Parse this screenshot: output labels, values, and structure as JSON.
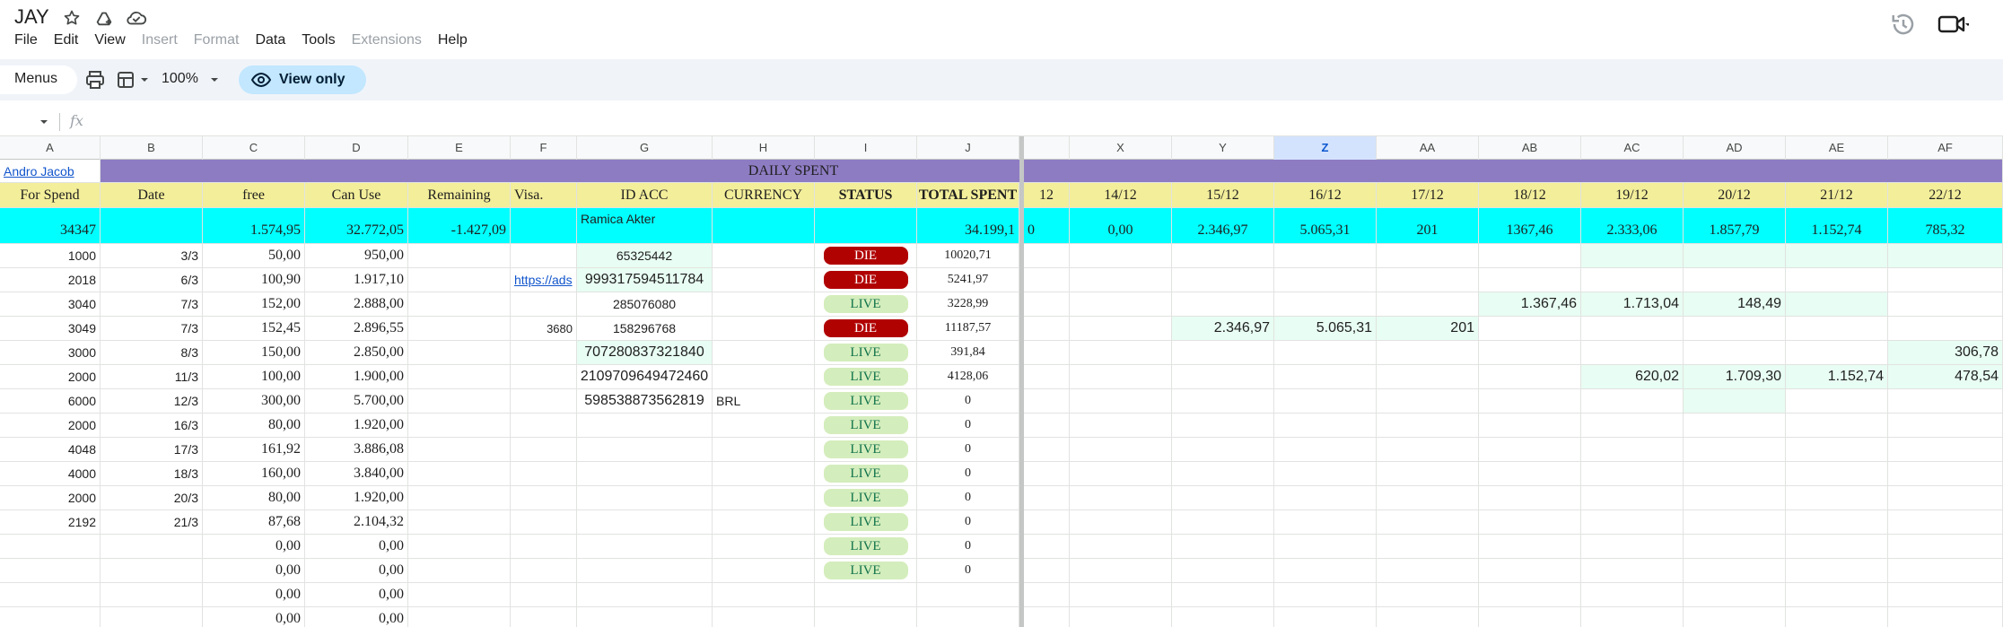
{
  "app": {
    "title": "JAY",
    "menus": [
      {
        "label": "File",
        "disabled": false
      },
      {
        "label": "Edit",
        "disabled": false
      },
      {
        "label": "View",
        "disabled": false
      },
      {
        "label": "Insert",
        "disabled": true
      },
      {
        "label": "Format",
        "disabled": true
      },
      {
        "label": "Data",
        "disabled": false
      },
      {
        "label": "Tools",
        "disabled": false
      },
      {
        "label": "Extensions",
        "disabled": true
      },
      {
        "label": "Help",
        "disabled": false
      }
    ]
  },
  "toolbar": {
    "menus_label": "Menus",
    "zoom": "100%",
    "view_only_label": "View only"
  },
  "formula_bar": {
    "fx_label": "fx"
  },
  "colors": {
    "purple_header": "#8e7cc3",
    "yellow_header": "#f3ee9a",
    "cyan_totals": "#00ffff",
    "mint_cell": "#e8fdf3",
    "die_chip": "#b10202",
    "live_chip": "#d4edbc",
    "view_only_pill": "#c2e7ff"
  },
  "grid": {
    "column_headers": [
      "A",
      "B",
      "C",
      "D",
      "E",
      "F",
      "G",
      "H",
      "I",
      "J",
      "X",
      "Y",
      "Z",
      "AA",
      "AB",
      "AC",
      "AD",
      "AE",
      "AF"
    ],
    "selected_column": "Z",
    "row1": {
      "a": "Andro Jacob",
      "title": "DAILY SPENT"
    },
    "row2": [
      "For Spend",
      "Date",
      "free",
      "Can Use",
      "Remaining",
      "Visa.",
      "ID ACC",
      "CURRENCY",
      "STATUS",
      "TOTAL SPENT",
      "12",
      "14/12",
      "15/12",
      "16/12",
      "17/12",
      "18/12",
      "19/12",
      "20/12",
      "21/12",
      "22/12"
    ],
    "row3": {
      "a": "34347",
      "c": "1.574,95",
      "d": "32.772,05",
      "e": "-1.427,09",
      "g": "Ramica Akter",
      "j": "34.199,1",
      "partial": "0",
      "x": "0,00",
      "y": "2.346,97",
      "z": "5.065,31",
      "aa": "201",
      "ab": "1367,46",
      "ac": "2.333,06",
      "ad": "1.857,79",
      "ae": "1.152,74",
      "af": "785,32"
    },
    "rows": [
      {
        "a": "1000",
        "b": "3/3",
        "c": "50,00",
        "d": "950,00",
        "e": "",
        "f": "",
        "g": "65325442",
        "h": "",
        "status": "DIE",
        "j": "10020,71",
        "y": "",
        "z": "",
        "aa": "",
        "ab": "",
        "ac": "",
        "ad": "",
        "ae": "",
        "af": ""
      },
      {
        "a": "2018",
        "b": "6/3",
        "c": "100,90",
        "d": "1.917,10",
        "e": "",
        "f": "https://ads",
        "g": "999317594511784",
        "h": "",
        "status": "DIE",
        "j": "5241,97",
        "y": "",
        "z": "",
        "aa": "",
        "ab": "",
        "ac": "",
        "ad": "",
        "ae": "",
        "af": ""
      },
      {
        "a": "3040",
        "b": "7/3",
        "c": "152,00",
        "d": "2.888,00",
        "e": "",
        "f": "",
        "g": "285076080",
        "h": "",
        "status": "LIVE",
        "j": "3228,99",
        "y": "",
        "z": "",
        "aa": "",
        "ab": "1.367,46",
        "ac": "1.713,04",
        "ad": "148,49",
        "ae": "",
        "af": ""
      },
      {
        "a": "3049",
        "b": "7/3",
        "c": "152,45",
        "d": "2.896,55",
        "e": "",
        "f": "3680",
        "g": "158296768",
        "h": "",
        "status": "DIE",
        "j": "11187,57",
        "y": "2.346,97",
        "z": "5.065,31",
        "aa": "201",
        "ab": "",
        "ac": "",
        "ad": "",
        "ae": "",
        "af": ""
      },
      {
        "a": "3000",
        "b": "8/3",
        "c": "150,00",
        "d": "2.850,00",
        "e": "",
        "f": "",
        "g": "707280837321840",
        "h": "",
        "status": "LIVE",
        "j": "391,84",
        "y": "",
        "z": "",
        "aa": "",
        "ab": "",
        "ac": "",
        "ad": "",
        "ae": "",
        "af": "306,78"
      },
      {
        "a": "2000",
        "b": "11/3",
        "c": "100,00",
        "d": "1.900,00",
        "e": "",
        "f": "",
        "g": "2109709649472460",
        "h": "",
        "status": "LIVE",
        "j": "4128,06",
        "y": "",
        "z": "",
        "aa": "",
        "ab": "",
        "ac": "620,02",
        "ad": "1.709,30",
        "ae": "1.152,74",
        "af": "478,54"
      },
      {
        "a": "6000",
        "b": "12/3",
        "c": "300,00",
        "d": "5.700,00",
        "e": "",
        "f": "",
        "g": "598538873562819",
        "h": "BRL",
        "status": "LIVE",
        "j": "0",
        "y": "",
        "z": "",
        "aa": "",
        "ab": "",
        "ac": "",
        "ad": "",
        "ae": "",
        "af": ""
      },
      {
        "a": "2000",
        "b": "16/3",
        "c": "80,00",
        "d": "1.920,00",
        "e": "",
        "f": "",
        "g": "",
        "h": "",
        "status": "LIVE",
        "j": "0",
        "y": "",
        "z": "",
        "aa": "",
        "ab": "",
        "ac": "",
        "ad": "",
        "ae": "",
        "af": ""
      },
      {
        "a": "4048",
        "b": "17/3",
        "c": "161,92",
        "d": "3.886,08",
        "e": "",
        "f": "",
        "g": "",
        "h": "",
        "status": "LIVE",
        "j": "0",
        "y": "",
        "z": "",
        "aa": "",
        "ab": "",
        "ac": "",
        "ad": "",
        "ae": "",
        "af": ""
      },
      {
        "a": "4000",
        "b": "18/3",
        "c": "160,00",
        "d": "3.840,00",
        "e": "",
        "f": "",
        "g": "",
        "h": "",
        "status": "LIVE",
        "j": "0",
        "y": "",
        "z": "",
        "aa": "",
        "ab": "",
        "ac": "",
        "ad": "",
        "ae": "",
        "af": ""
      },
      {
        "a": "2000",
        "b": "20/3",
        "c": "80,00",
        "d": "1.920,00",
        "e": "",
        "f": "",
        "g": "",
        "h": "",
        "status": "LIVE",
        "j": "0",
        "y": "",
        "z": "",
        "aa": "",
        "ab": "",
        "ac": "",
        "ad": "",
        "ae": "",
        "af": ""
      },
      {
        "a": "2192",
        "b": "21/3",
        "c": "87,68",
        "d": "2.104,32",
        "e": "",
        "f": "",
        "g": "",
        "h": "",
        "status": "LIVE",
        "j": "0",
        "y": "",
        "z": "",
        "aa": "",
        "ab": "",
        "ac": "",
        "ad": "",
        "ae": "",
        "af": ""
      },
      {
        "a": "",
        "b": "",
        "c": "0,00",
        "d": "0,00",
        "e": "",
        "f": "",
        "g": "",
        "h": "",
        "status": "LIVE",
        "j": "0",
        "y": "",
        "z": "",
        "aa": "",
        "ab": "",
        "ac": "",
        "ad": "",
        "ae": "",
        "af": ""
      },
      {
        "a": "",
        "b": "",
        "c": "0,00",
        "d": "0,00",
        "e": "",
        "f": "",
        "g": "",
        "h": "",
        "status": "LIVE",
        "j": "0",
        "y": "",
        "z": "",
        "aa": "",
        "ab": "",
        "ac": "",
        "ad": "",
        "ae": "",
        "af": ""
      },
      {
        "a": "",
        "b": "",
        "c": "0,00",
        "d": "0,00",
        "e": "",
        "f": "",
        "g": "",
        "h": "",
        "status": "",
        "j": "",
        "y": "",
        "z": "",
        "aa": "",
        "ab": "",
        "ac": "",
        "ad": "",
        "ae": "",
        "af": ""
      },
      {
        "a": "",
        "b": "",
        "c": "0,00",
        "d": "0,00",
        "e": "",
        "f": "",
        "g": "",
        "h": "",
        "status": "",
        "j": "",
        "y": "",
        "z": "",
        "aa": "",
        "ab": "",
        "ac": "",
        "ad": "",
        "ae": "",
        "af": ""
      }
    ]
  }
}
